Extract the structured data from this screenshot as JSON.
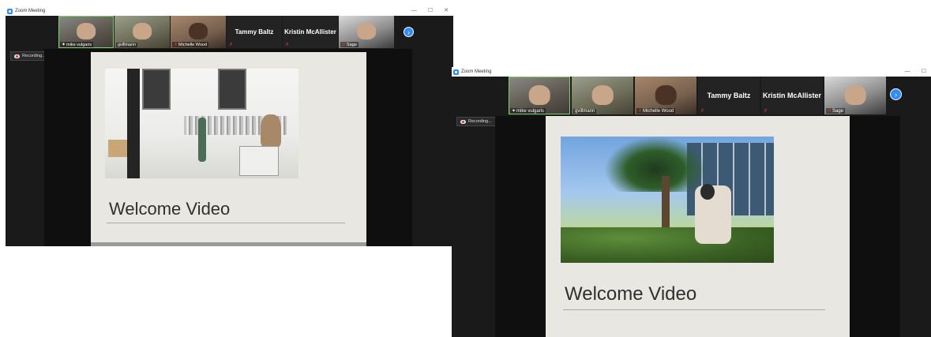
{
  "windows": [
    {
      "title": "Zoom Meeting",
      "controls": [
        "—",
        "☐",
        "✕"
      ],
      "participants": [
        {
          "name": "mike vulgaris",
          "type": "video",
          "active": true,
          "pinned": true
        },
        {
          "name": "gvillmann",
          "type": "video"
        },
        {
          "name": "Michelle Wood",
          "type": "video",
          "muted": true
        },
        {
          "name": "Tammy Baltz",
          "type": "name",
          "muted": true
        },
        {
          "name": "Kristin McAllister",
          "type": "name",
          "muted": true
        },
        {
          "name": "Sage",
          "type": "video",
          "muted": true
        }
      ],
      "next_icon": "chevron-right-icon",
      "recording_label": "Recording...",
      "slide": {
        "title": "Welcome Video",
        "photo": "gallery"
      }
    },
    {
      "title": "Zoom Meeting",
      "controls": [
        "—",
        "☐"
      ],
      "participants": [
        {
          "name": "mike vulgaris",
          "type": "video",
          "active": true,
          "pinned": true
        },
        {
          "name": "gvillmann",
          "type": "video"
        },
        {
          "name": "Michelle Wood",
          "type": "video",
          "muted": true
        },
        {
          "name": "Tammy Baltz",
          "type": "name",
          "muted": true
        },
        {
          "name": "Kristin McAllister",
          "type": "name",
          "muted": true
        },
        {
          "name": "Sage",
          "type": "video",
          "muted": true
        }
      ],
      "next_icon": "chevron-right-icon",
      "recording_label": "Recording...",
      "slide": {
        "title": "Welcome Video",
        "photo": "palm"
      }
    }
  ],
  "colors": {
    "zoom_blue": "#2d8cff",
    "muted_red": "#e0312f",
    "active_speaker_green": "#7bd36a"
  }
}
